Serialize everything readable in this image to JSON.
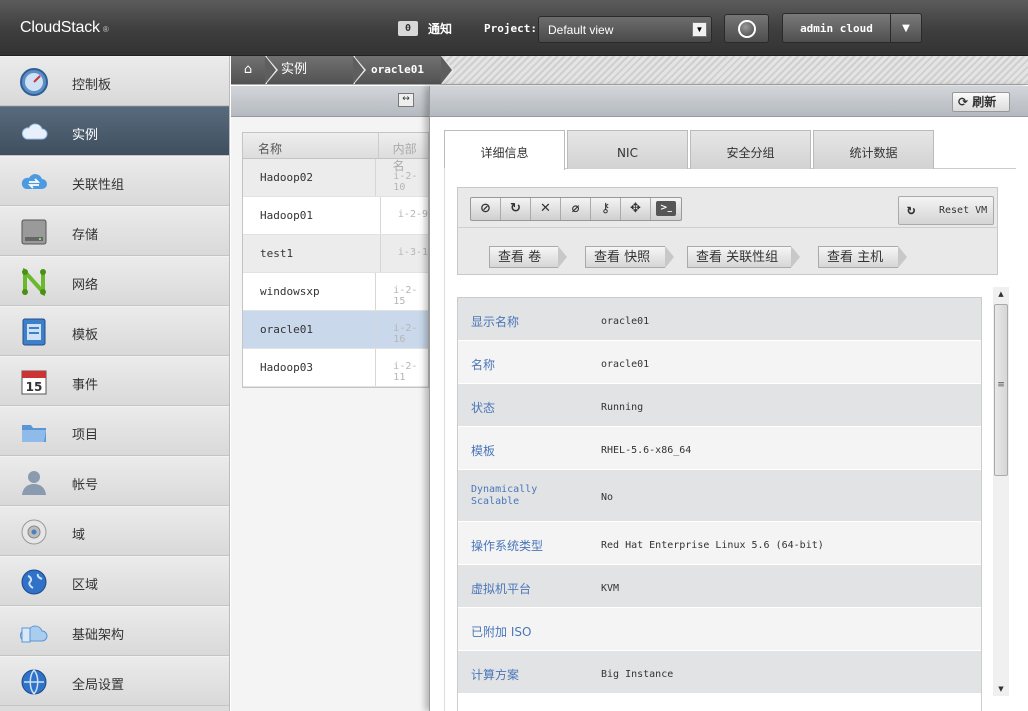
{
  "app": {
    "name": "CloudStack",
    "mark": "®"
  },
  "header": {
    "notification_count": "0",
    "notification_label": "通知",
    "project_label": "Project:",
    "project_value": "Default view",
    "user": "admin cloud"
  },
  "sidebar": {
    "items": [
      {
        "label": "控制板",
        "icon": "dashboard-icon"
      },
      {
        "label": "实例",
        "icon": "cloud-icon"
      },
      {
        "label": "关联性组",
        "icon": "affinity-icon"
      },
      {
        "label": "存储",
        "icon": "storage-icon"
      },
      {
        "label": "网络",
        "icon": "network-icon"
      },
      {
        "label": "模板",
        "icon": "template-icon"
      },
      {
        "label": "事件",
        "icon": "calendar-icon"
      },
      {
        "label": "项目",
        "icon": "folder-icon"
      },
      {
        "label": "帐号",
        "icon": "user-icon"
      },
      {
        "label": "域",
        "icon": "domain-icon"
      },
      {
        "label": "区域",
        "icon": "globe-icon"
      },
      {
        "label": "基础架构",
        "icon": "infrastructure-icon"
      },
      {
        "label": "全局设置",
        "icon": "settings-globe-icon"
      }
    ],
    "active_index": 1
  },
  "breadcrumb": {
    "section": "实例",
    "current": "oracle01"
  },
  "list": {
    "col_name": "名称",
    "col_internal": "内部名",
    "rows": [
      {
        "name": "Hadoop02",
        "internal": "i-2-10"
      },
      {
        "name": "Hadoop01",
        "internal": "i-2-9"
      },
      {
        "name": "test1",
        "internal": "i-3-1"
      },
      {
        "name": "windowsxp",
        "internal": "i-2-15"
      },
      {
        "name": "oracle01",
        "internal": "i-2-16"
      },
      {
        "name": "Hadoop03",
        "internal": "i-2-11"
      }
    ],
    "selected_index": 4
  },
  "detail": {
    "refresh_label": "刷新",
    "tabs": [
      "详细信息",
      "NIC",
      "安全分组",
      "统计数据"
    ],
    "active_tab": 0,
    "reset_vm_label": "Reset VM",
    "view_buttons": [
      "查看 卷",
      "查看 快照",
      "查看 关联性组",
      "查看 主机"
    ],
    "fields": [
      {
        "key": "显示名称",
        "value": "oracle01"
      },
      {
        "key": "名称",
        "value": "oracle01"
      },
      {
        "key": "状态",
        "value": "Running"
      },
      {
        "key": "模板",
        "value": "RHEL-5.6-x86_64"
      },
      {
        "key": "Dynamically Scalable",
        "value": "No"
      },
      {
        "key": "操作系统类型",
        "value": "Red Hat Enterprise Linux 5.6 (64-bit)"
      },
      {
        "key": "虚拟机平台",
        "value": "KVM"
      },
      {
        "key": "已附加 ISO",
        "value": ""
      },
      {
        "key": "计算方案",
        "value": "Big Instance"
      }
    ]
  }
}
